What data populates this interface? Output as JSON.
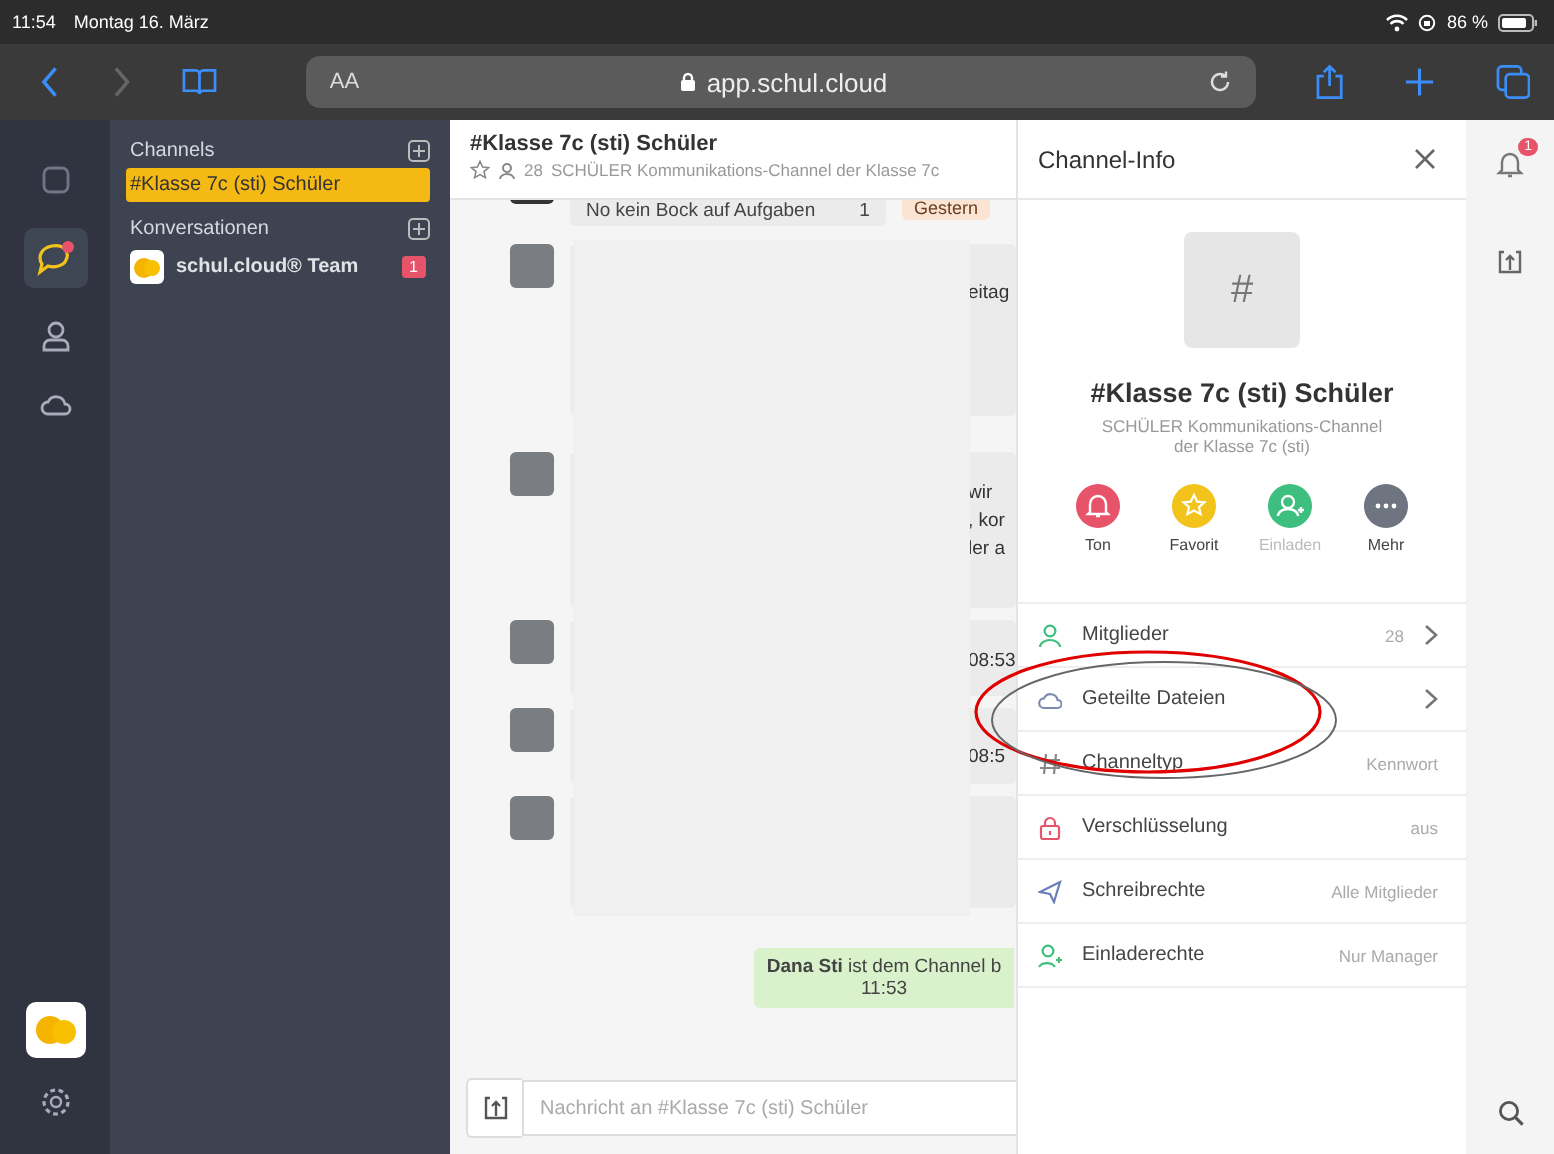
{
  "status_bar": {
    "time": "11:54",
    "date": "Montag 16. März",
    "battery": "86 %"
  },
  "browser": {
    "text_size": "AA",
    "url": "app.schul.cloud"
  },
  "sidebar": {
    "channels_heading": "Channels",
    "channels": [
      {
        "label": "#Klasse 7c (sti) Schüler",
        "selected": true
      }
    ],
    "conversations_heading": "Konversationen",
    "conversations": [
      {
        "label": "schul.cloud® Team",
        "badge": "1",
        "selected": false
      }
    ]
  },
  "chat": {
    "title": "#Klasse 7c (sti) Schüler",
    "members": "28",
    "description": "SCHÜLER Kommunikations-Channel der Klasse 7c",
    "top_message": {
      "text": "No kein Bock auf Aufgaben",
      "time": "1"
    },
    "date_badge": "Gestern",
    "messages": [
      {
        "fragments": [
          "eitag"
        ]
      },
      {
        "fragments": [
          "wir",
          ", kor",
          "ler a"
        ]
      },
      {
        "fragments": [
          "08:53"
        ]
      },
      {
        "fragments": [
          "08:5"
        ]
      }
    ],
    "system_message": {
      "name": "Dana Sti",
      "text": "ist dem Channel b",
      "time": "11:53"
    },
    "input": {
      "placeholder": "Nachricht an #Klasse 7c (sti) Schüler"
    }
  },
  "channel_info": {
    "title": "Channel-Info",
    "avatar": "#",
    "name": "#Klasse 7c (sti) Schüler",
    "description": "SCHÜLER Kommunikations-Channel der Klasse 7c (sti)",
    "actions": [
      {
        "kind": "sound",
        "label": "Ton",
        "disabled": false
      },
      {
        "kind": "favorite",
        "label": "Favorit",
        "disabled": false
      },
      {
        "kind": "invite",
        "label": "Einladen",
        "disabled": true
      },
      {
        "kind": "more",
        "label": "Mehr",
        "disabled": false
      }
    ],
    "rows": [
      {
        "kind": "members",
        "label": "Mitglieder",
        "value": "28",
        "chevron": true
      },
      {
        "kind": "files",
        "label": "Geteilte Dateien",
        "chevron": true
      },
      {
        "kind": "type",
        "label": "Channeltyp",
        "value": "Kennwort",
        "chevron": false
      },
      {
        "kind": "lock",
        "label": "Verschlüsselung",
        "value": "aus",
        "chevron": false
      },
      {
        "kind": "write",
        "label": "Schreibrechte",
        "value": "Alle Mitglieder",
        "chevron": false
      },
      {
        "kind": "invite",
        "label": "Einladerechte",
        "value": "Nur Manager",
        "chevron": false
      }
    ]
  },
  "notifications": {
    "badge": "1"
  }
}
